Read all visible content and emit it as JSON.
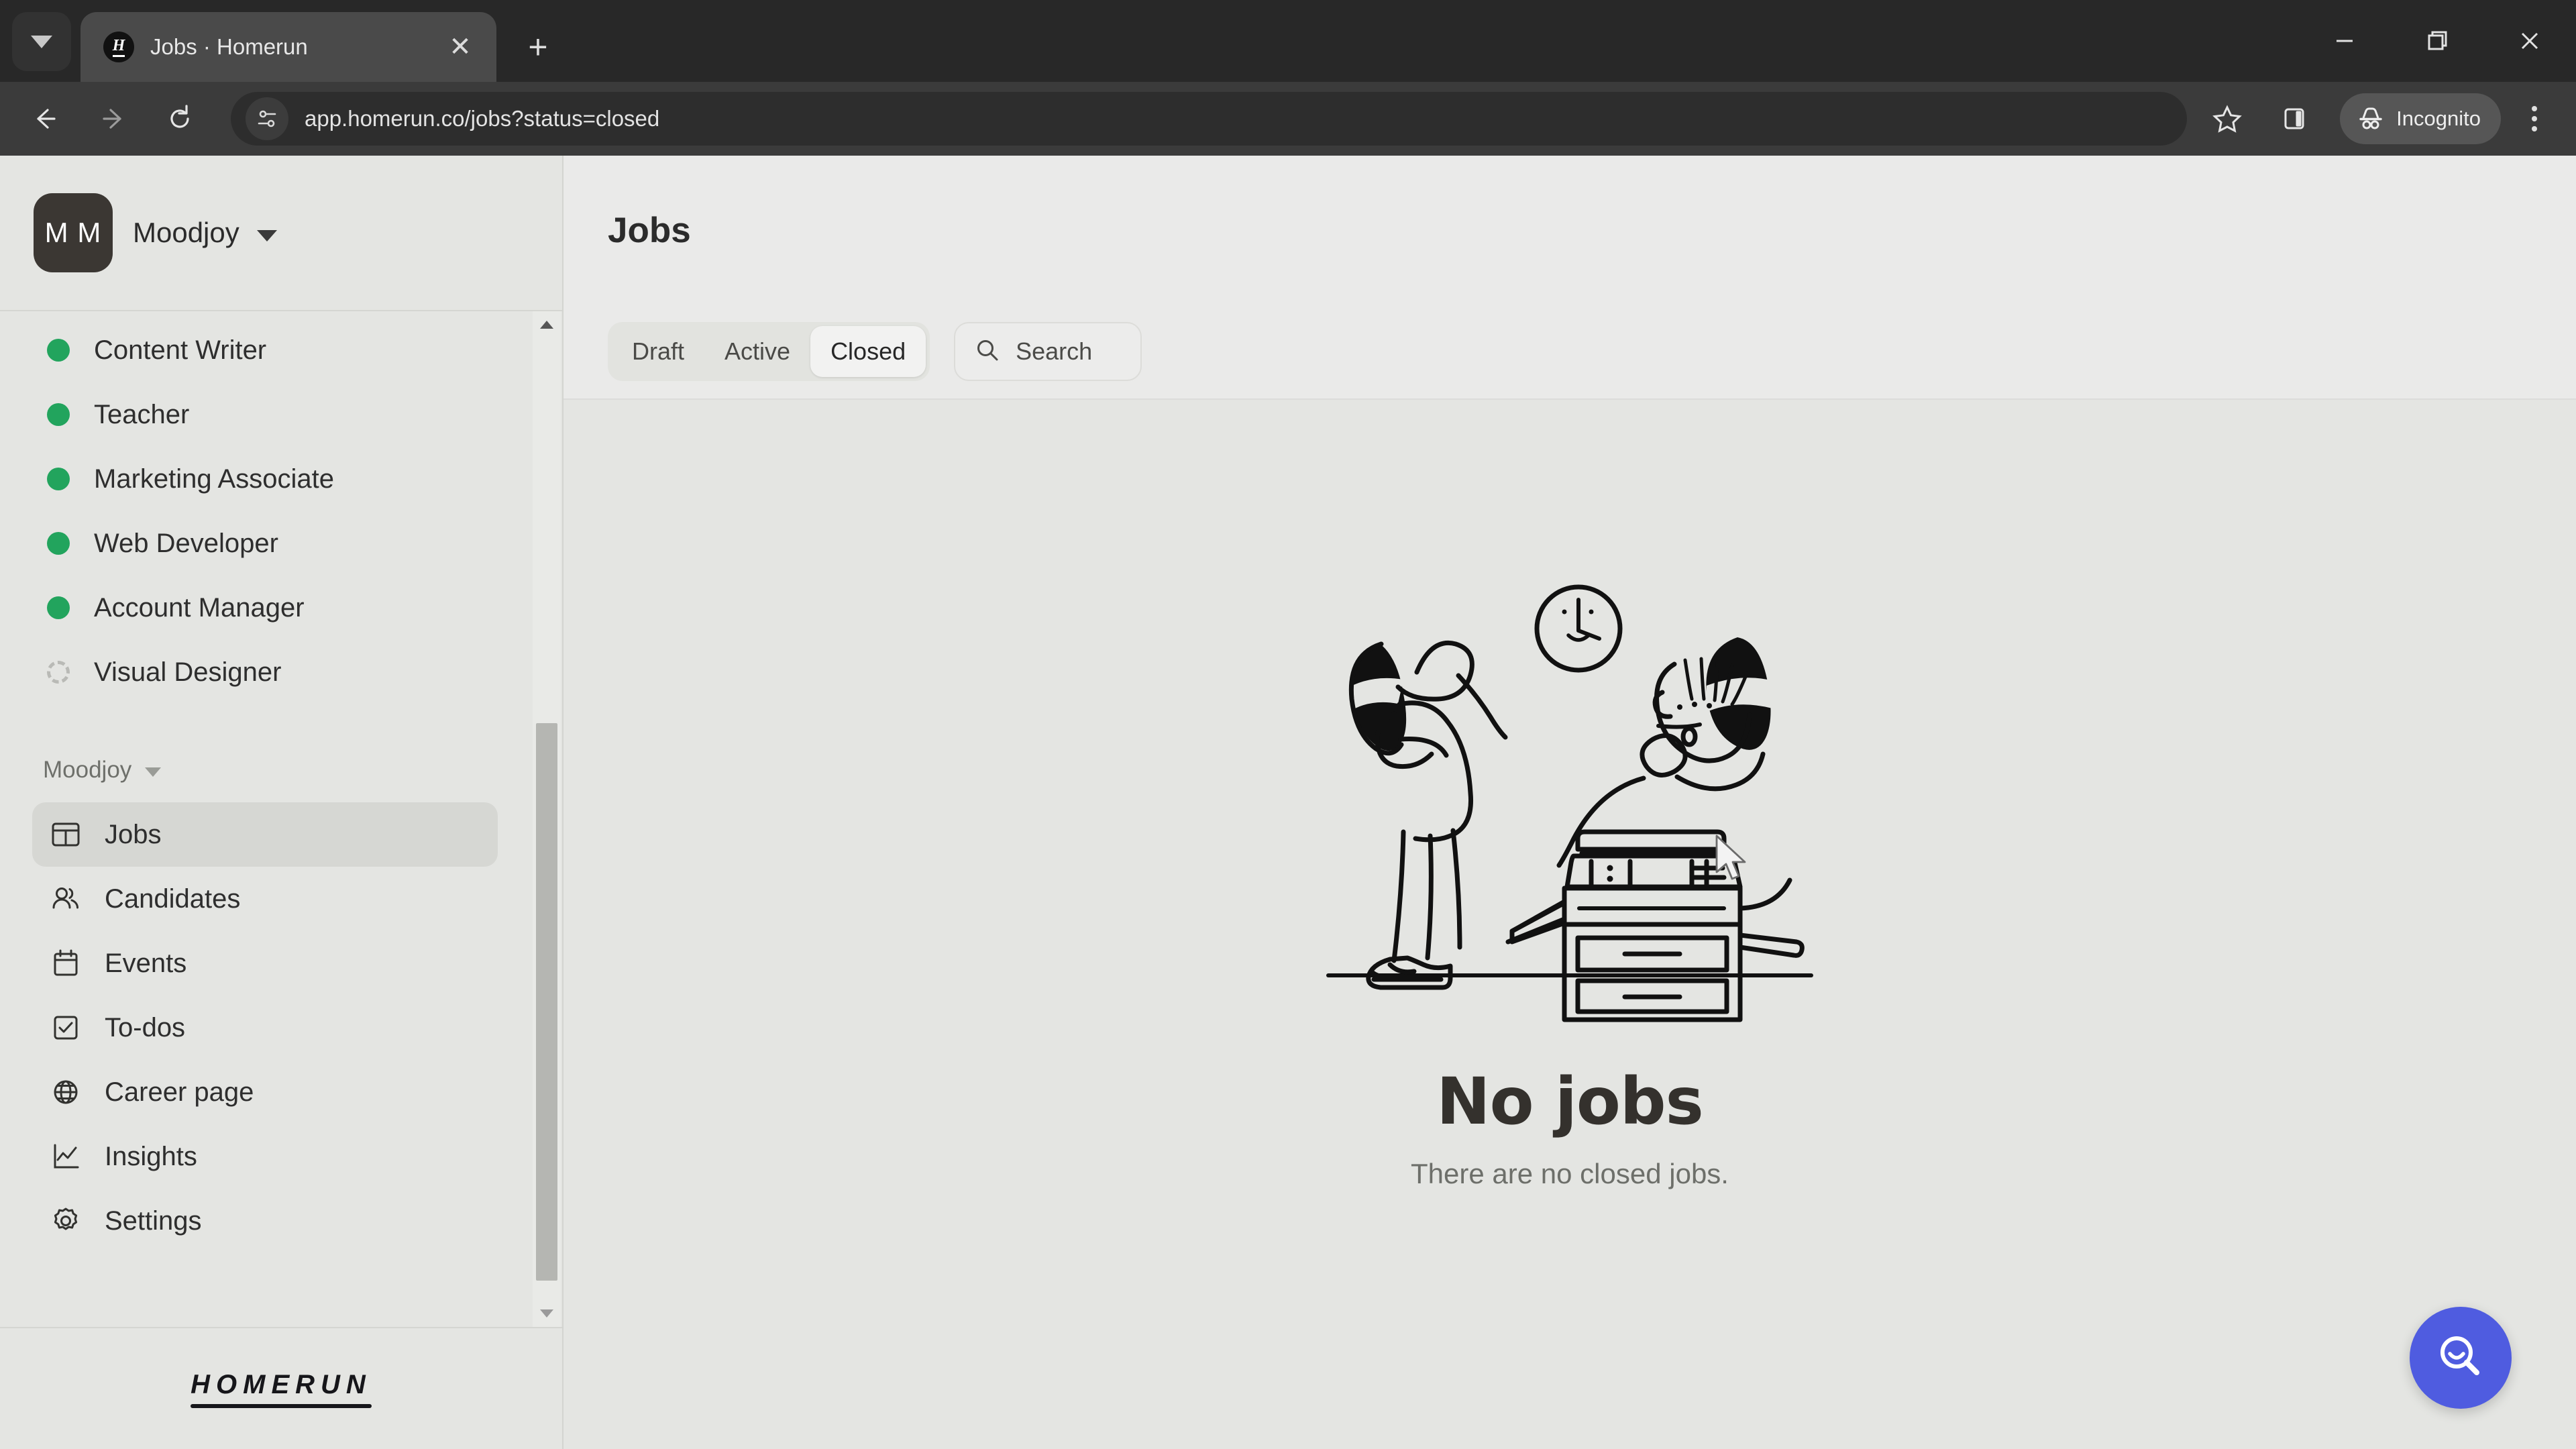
{
  "browser": {
    "tab": {
      "title": "Jobs · Homerun",
      "favicon_letter": "H",
      "close_label": "✕"
    },
    "newtab_label": "+",
    "tab_search_icon": "chevron-down-icon",
    "window_controls": {
      "minimize": "–",
      "maximize": "❐",
      "close": "✕"
    },
    "nav": {
      "back": "←",
      "forward": "→",
      "reload": "↻"
    },
    "omnibox": {
      "url": "app.homerun.co/jobs?status=closed",
      "site_icon": "tune-sliders-icon"
    },
    "actions": {
      "bookmark": "star-icon",
      "side_panel": "side-panel-icon",
      "menu": "kebab-menu-icon"
    },
    "incognito": {
      "label": "Incognito",
      "icon": "incognito-hat-icon"
    }
  },
  "sidebar": {
    "org": {
      "initials": "M M",
      "name": "Moodjoy",
      "caret": "▾"
    },
    "jobs": [
      {
        "label": "Content Writer",
        "status": "open"
      },
      {
        "label": "Teacher",
        "status": "open"
      },
      {
        "label": "Marketing Associate",
        "status": "open"
      },
      {
        "label": "Web Developer",
        "status": "open"
      },
      {
        "label": "Account Manager",
        "status": "open"
      },
      {
        "label": "Visual Designer",
        "status": "draft"
      }
    ],
    "section": {
      "label": "Moodjoy",
      "caret": "▾"
    },
    "nav_items": [
      {
        "label": "Jobs",
        "icon": "jobs-board-icon",
        "active": true
      },
      {
        "label": "Candidates",
        "icon": "people-icon",
        "active": false
      },
      {
        "label": "Events",
        "icon": "calendar-icon",
        "active": false
      },
      {
        "label": "To-dos",
        "icon": "checkbox-icon",
        "active": false
      },
      {
        "label": "Career page",
        "icon": "globe-icon",
        "active": false
      },
      {
        "label": "Insights",
        "icon": "line-chart-icon",
        "active": false
      },
      {
        "label": "Settings",
        "icon": "gear-icon",
        "active": false
      }
    ],
    "footer_logo": "HOMERUN",
    "scrollbar": {
      "up": "▴",
      "down": "▾"
    }
  },
  "main": {
    "page_title": "Jobs",
    "tabs": [
      {
        "label": "Draft",
        "active": false
      },
      {
        "label": "Active",
        "active": false
      },
      {
        "label": "Closed",
        "active": true
      }
    ],
    "search": {
      "label": "Search",
      "icon": "search-icon"
    },
    "empty_state": {
      "title": "No jobs",
      "subtitle": "There are no closed jobs.",
      "illustration": "two-people-at-copier-with-clock"
    },
    "fab": {
      "icon": "search-smile-icon"
    }
  },
  "colors": {
    "accent_blue": "#4f5ce0",
    "status_green": "#22a45d",
    "sidebar_bg": "#e4e5e2",
    "header_bg": "#eaeae9",
    "chrome_dark": "#3b3b3b"
  }
}
